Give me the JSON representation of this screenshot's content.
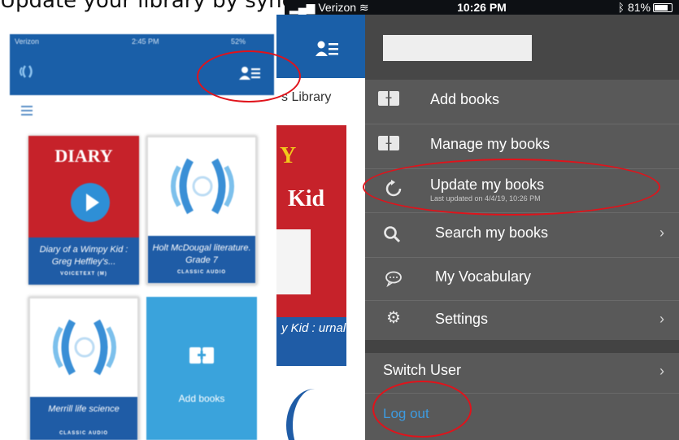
{
  "caption": "Update your library by syncing with server for new assignments:",
  "left_phone": {
    "status": {
      "carrier": "Verizon",
      "time": "2:45 PM",
      "battery": "52%"
    },
    "books": [
      {
        "title_art": "DIARY",
        "title": "Diary of a Wimpy Kid : Greg Heffley's...",
        "badge": "VOICETEXT (M)"
      },
      {
        "title": "Holt McDougal literature. Grade 7",
        "badge": "CLASSIC AUDIO"
      },
      {
        "title": "Merrill life science",
        "badge": "CLASSIC AUDIO"
      }
    ],
    "add_books_label": "Add books"
  },
  "middle": {
    "library_title": "s Library",
    "book_band": "y Kid : urnal"
  },
  "right_phone": {
    "status": {
      "carrier": "Verizon",
      "time": "10:26 PM",
      "battery": "81%"
    },
    "menu": [
      {
        "label": "Add books",
        "icon": "book-plus-icon"
      },
      {
        "label": "Manage my books",
        "icon": "book-minus-icon"
      },
      {
        "label": "Update my books",
        "sub": "Last updated on 4/4/19, 10:26 PM",
        "icon": "refresh-icon"
      },
      {
        "label": "Search my books",
        "icon": "search-icon",
        "chevron": "›"
      },
      {
        "label": "My Vocabulary",
        "icon": "speech-bubble-icon"
      },
      {
        "label": "Settings",
        "icon": "gear-icon",
        "chevron": "›"
      }
    ],
    "switch_user": "Switch User",
    "switch_chevron": "›",
    "log_out": "Log out"
  },
  "colors": {
    "nav_blue": "#1a5fa8",
    "drawer": "#595959",
    "logout": "#3d9be0",
    "annotation": "#e0131b"
  }
}
